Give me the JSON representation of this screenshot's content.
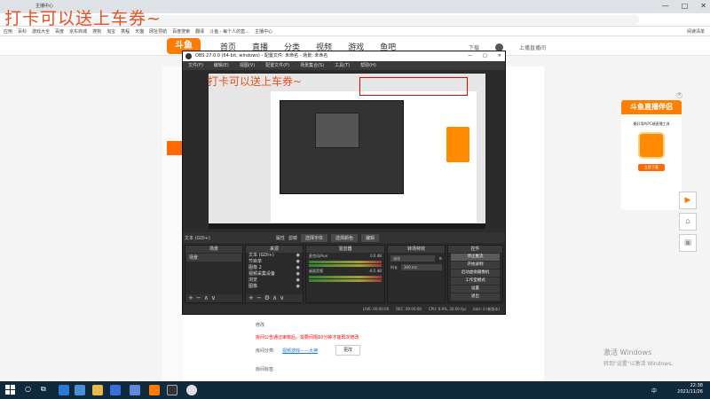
{
  "browser": {
    "tab_title": "主播中心",
    "window_controls": [
      "—",
      "□",
      "✕"
    ],
    "bookmarks": [
      "应用",
      "百科",
      "游戏大全",
      "百度",
      "京东商城",
      "搜狗",
      "淘宝",
      "携程",
      "天猫",
      "网址导航",
      "百度搜索",
      "翻译",
      "斗鱼 - 每个人的直...",
      "主播中心"
    ],
    "bookmarks_right": "阅读清单"
  },
  "overlay": {
    "main_text": "打卡可以送上车券~",
    "obs_text": "打卡可以送上车券~"
  },
  "site": {
    "logo": "斗鱼",
    "nav": [
      "首页",
      "直播",
      "分类",
      "视频",
      "游戏",
      "鱼吧"
    ],
    "header_right": [
      "下载",
      "上播直播间"
    ],
    "modify_label": "修改",
    "notice": "房间公告通过审核后，需要间隔10分钟才能再次修改",
    "share_label": "房间分类:",
    "share_link": "视频游戏——大神",
    "change_btn": "更改",
    "category_label": "房间标签:"
  },
  "promo": {
    "title": "斗鱼直播伴侣",
    "subtitle": "最好用的PC端直播工具",
    "button": "立即下载",
    "close": "×"
  },
  "float_buttons": [
    "▶",
    "⌂",
    "▣"
  ],
  "obs": {
    "title": "OBS 27.0.0 (64-bit, windows) - 配置文件: 未命名 - 场景: 未命名",
    "menu": [
      "文件(F)",
      "编辑(E)",
      "视图(V)",
      "配置文件(P)",
      "场景集合(S)",
      "工具(T)",
      "帮助(H)"
    ],
    "source_bar": {
      "label": "文本 (GDI+)",
      "buttons": [
        "属性",
        "滤镜",
        "选择字体",
        "选择颜色",
        "编辑"
      ]
    },
    "docks": {
      "scenes": {
        "title": "场景",
        "items": [
          "场景"
        ]
      },
      "sources": {
        "title": "来源",
        "items": [
          "文本 (GDI+)",
          "节目单",
          "图像 2",
          "视频采集设备",
          "浏览",
          "图像"
        ]
      },
      "mixer": {
        "title": "混音器",
        "channels": [
          "麦克风/Aux",
          "桌面音频"
        ],
        "levels": [
          "0.0 dB",
          "-6.5 dB"
        ]
      },
      "transitions": {
        "title": "转场特效",
        "mode": "淡化",
        "duration_label": "时长",
        "duration": "300 ms"
      },
      "controls": {
        "title": "控件",
        "buttons": [
          "停止推流",
          "开始录制",
          "启动虚拟摄像机",
          "工作室模式",
          "设置",
          "退出"
        ]
      }
    },
    "status": [
      "LIVE: 00:00:00",
      "REC: 00:00:00",
      "CPU: 6.9%, 30.00 fps",
      "kb/s: 0 (新版本)"
    ]
  },
  "activate": {
    "line1": "激活 Windows",
    "line2": "转到\"设置\"以激活 Windows。"
  },
  "taskbar": {
    "time": "22:38",
    "date": "2021/11/26",
    "lang": "中"
  }
}
